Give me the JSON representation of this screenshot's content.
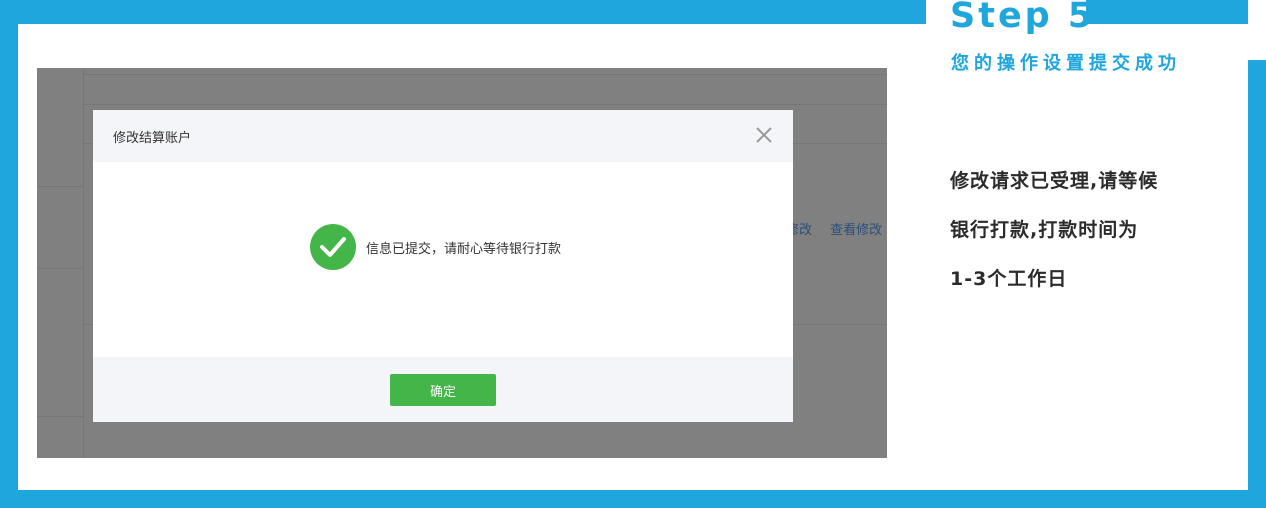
{
  "step": {
    "title": "Step 5",
    "subtitle": "您的操作设置提交成功"
  },
  "description": {
    "line1": "修改请求已受理,请等候",
    "line2": "银行打款,打款时间为",
    "line3": "1-3个工作日"
  },
  "background": {
    "link1": "修改",
    "link2": "查看修改"
  },
  "modal": {
    "title": "修改结算账户",
    "close_icon": "close-icon",
    "success_icon": "check-circle-icon",
    "message": "信息已提交，请耐心等待银行打款",
    "confirm_label": "确定"
  },
  "colors": {
    "frame": "#1ea6dd",
    "accent_text": "#1ea6dd",
    "success": "#44b549",
    "overlay": "#808080"
  }
}
